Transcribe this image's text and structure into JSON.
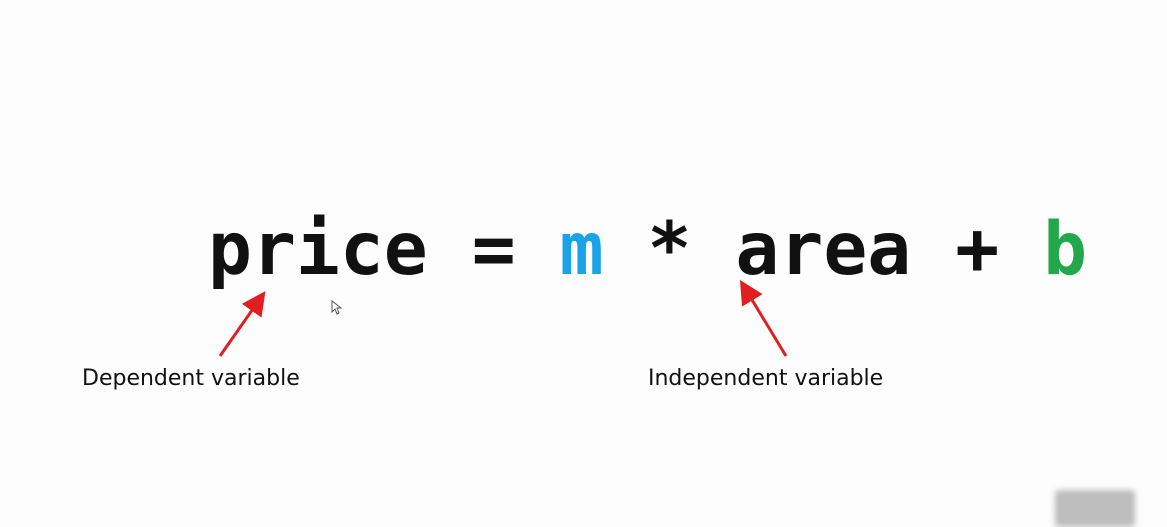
{
  "equation": {
    "dependent": "price",
    "equals": "=",
    "slope": "m",
    "times": "*",
    "independent": "area",
    "plus": "+",
    "intercept": "b"
  },
  "labels": {
    "dependent": "Dependent variable",
    "independent": "Independent variable"
  },
  "colors": {
    "text": "#111111",
    "slope": "#1aa3e8",
    "intercept": "#22a84a",
    "arrow": "#e02020"
  }
}
